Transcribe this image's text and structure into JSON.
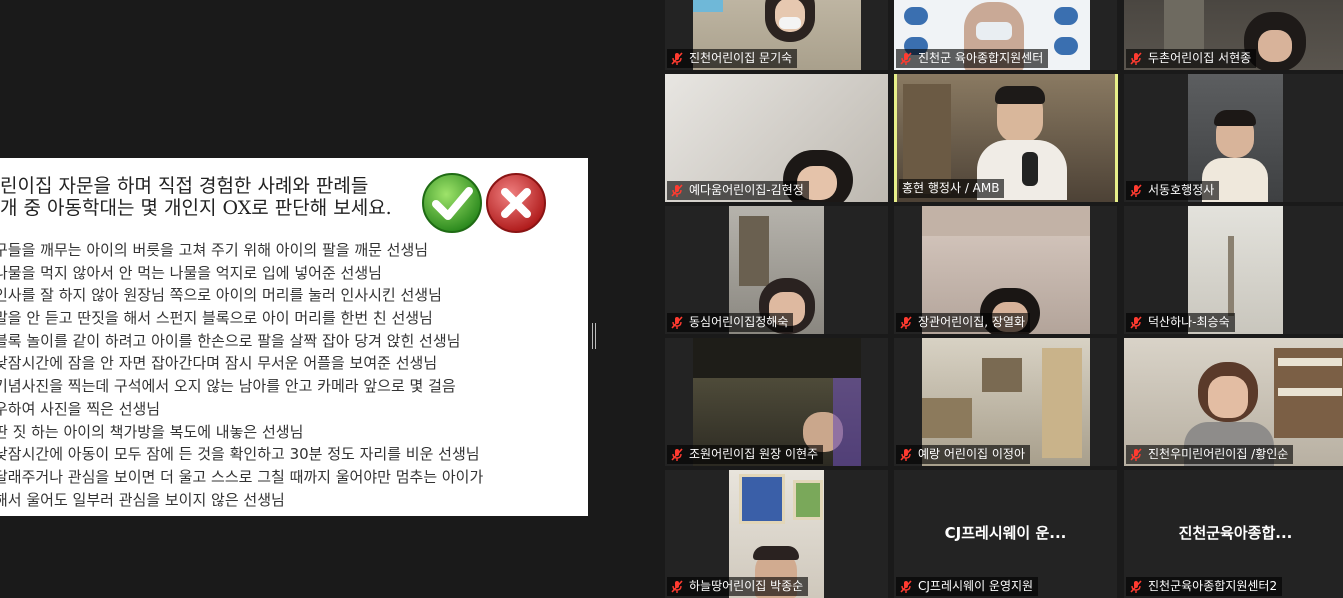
{
  "slide": {
    "title_line1": "린이집 자문을 하며 직접 경험한 사례와 판례들",
    "title_line2": "개 중 아동학대는 몇 개인지 OX로 판단해 보세요.",
    "items": [
      "구들을 깨무는 아이의 버릇을 고쳐 주기 위해 아이의 팔을 깨문 선생님",
      "나물을 먹지 않아서 안 먹는 나물을 억지로 입에 넣어준 선생님",
      "인사를 잘 하지 않아 원장님 쪽으로 아이의 머리를 눌러 인사시킨 선생님",
      "말을 안 듣고 딴짓을 해서 스펀지 블록으로 아이 머리를 한번 친 선생님",
      "블록 놀이를 같이 하려고 아이를 한손으로 팔을 살짝 잡아 당겨 앉힌 선생님",
      "낮잠시간에 잠을 안 자면 잡아간다며 잠시 무서운 어플을 보여준 선생님",
      "기념사진을 찍는데 구석에서 오지 않는 남아를 안고 카메라 앞으로 몇 걸음",
      "우하여 사진을 찍은 선생님",
      "딴 짓 하는 아이의 책가방을 복도에 내놓은 선생님",
      "낮잠시간에 아동이 모두 잠에 든 것을 확인하고 30분 정도 자리를 비운 선생님",
      "달래주거나 관심을 보이면 더 울고 스스로 그칠 때까지 울어야만 멈추는 아이가",
      "해서 울어도 일부러 관심을 보이지 않은 선생님"
    ]
  },
  "participants": [
    {
      "name": "진천어린이집 문기숙"
    },
    {
      "name": "진천군 육아종합지원센터"
    },
    {
      "name": "두촌어린이집 서현종"
    },
    {
      "name": "예다움어린이집-김현정"
    },
    {
      "name": "홍현 행정사 / AMB"
    },
    {
      "name": "서동호행정사"
    },
    {
      "name": "동심어린이집정해숙"
    },
    {
      "name": "장관어린이집, 장열화"
    },
    {
      "name": "덕산하나-최승숙"
    },
    {
      "name": "조원어린이집 원장 이현주"
    },
    {
      "name": "예랑 어린이집 이정아"
    },
    {
      "name": "진천우미린어린이집 /황인순"
    },
    {
      "name": "하늘땅어린이집 박종순"
    },
    {
      "name": "CJ프레시웨이 운영지원",
      "display": "CJ프레시웨이 운..."
    },
    {
      "name": "진천군육아종합지원센터2",
      "display": "진천군육아종합..."
    }
  ]
}
